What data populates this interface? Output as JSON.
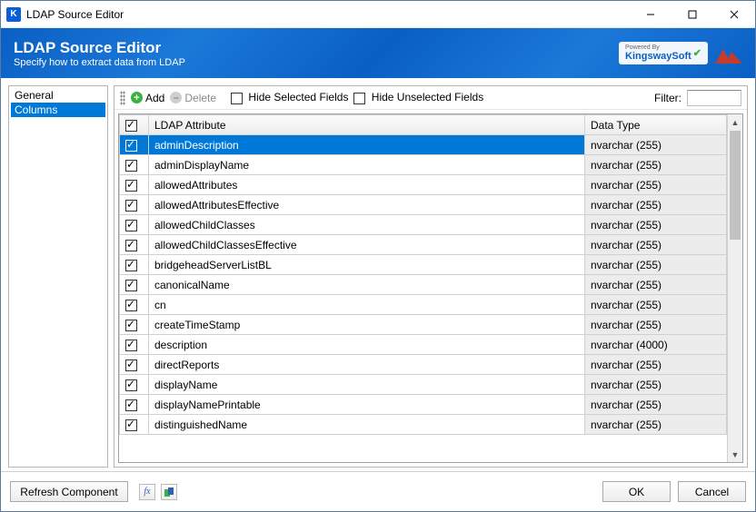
{
  "window": {
    "title": "LDAP Source Editor"
  },
  "header": {
    "title": "LDAP Source Editor",
    "subtitle": "Specify how to extract data from LDAP",
    "brand_powered": "Powered By",
    "brand_name": "KingswaySoft"
  },
  "sidebar": {
    "items": [
      {
        "label": "General",
        "selected": false
      },
      {
        "label": "Columns",
        "selected": true
      }
    ]
  },
  "toolbar": {
    "add_label": "Add",
    "delete_label": "Delete",
    "hide_selected_label": "Hide Selected Fields",
    "hide_unselected_label": "Hide Unselected Fields",
    "hide_selected_checked": false,
    "hide_unselected_checked": false,
    "filter_label": "Filter:",
    "filter_value": ""
  },
  "grid": {
    "header_checked": true,
    "columns": {
      "attr": "LDAP Attribute",
      "type": "Data Type"
    },
    "rows": [
      {
        "checked": true,
        "attr": "adminDescription",
        "type": "nvarchar (255)",
        "selected": true
      },
      {
        "checked": true,
        "attr": "adminDisplayName",
        "type": "nvarchar (255)"
      },
      {
        "checked": true,
        "attr": "allowedAttributes",
        "type": "nvarchar (255)"
      },
      {
        "checked": true,
        "attr": "allowedAttributesEffective",
        "type": "nvarchar (255)"
      },
      {
        "checked": true,
        "attr": "allowedChildClasses",
        "type": "nvarchar (255)"
      },
      {
        "checked": true,
        "attr": "allowedChildClassesEffective",
        "type": "nvarchar (255)"
      },
      {
        "checked": true,
        "attr": "bridgeheadServerListBL",
        "type": "nvarchar (255)"
      },
      {
        "checked": true,
        "attr": "canonicalName",
        "type": "nvarchar (255)"
      },
      {
        "checked": true,
        "attr": "cn",
        "type": "nvarchar (255)"
      },
      {
        "checked": true,
        "attr": "createTimeStamp",
        "type": "nvarchar (255)"
      },
      {
        "checked": true,
        "attr": "description",
        "type": "nvarchar (4000)"
      },
      {
        "checked": true,
        "attr": "directReports",
        "type": "nvarchar (255)"
      },
      {
        "checked": true,
        "attr": "displayName",
        "type": "nvarchar (255)"
      },
      {
        "checked": true,
        "attr": "displayNamePrintable",
        "type": "nvarchar (255)"
      },
      {
        "checked": true,
        "attr": "distinguishedName",
        "type": "nvarchar (255)"
      }
    ]
  },
  "footer": {
    "refresh_label": "Refresh Component",
    "ok_label": "OK",
    "cancel_label": "Cancel"
  }
}
